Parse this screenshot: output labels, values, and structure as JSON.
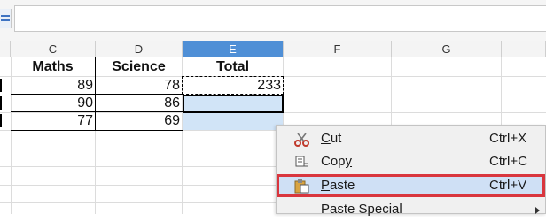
{
  "columns": [
    {
      "id": "C",
      "label": "C",
      "selected": false
    },
    {
      "id": "D",
      "label": "D",
      "selected": false
    },
    {
      "id": "E",
      "label": "E",
      "selected": true
    },
    {
      "id": "F",
      "label": "F",
      "selected": false
    },
    {
      "id": "G",
      "label": "G",
      "selected": false
    }
  ],
  "sheet": {
    "headers": {
      "maths": "Maths",
      "science": "Science",
      "total": "Total"
    },
    "rows": [
      {
        "maths": "89",
        "science": "78",
        "total": "233"
      },
      {
        "maths": "90",
        "science": "86",
        "total": ""
      },
      {
        "maths": "77",
        "science": "69",
        "total": ""
      }
    ]
  },
  "context_menu": {
    "items": [
      {
        "label_pre": "",
        "label_ul": "C",
        "label_post": "ut",
        "shortcut": "Ctrl+X",
        "icon": "scissors-icon"
      },
      {
        "label_pre": "Cop",
        "label_ul": "y",
        "label_post": "",
        "shortcut": "Ctrl+C",
        "icon": "copy-icon"
      },
      {
        "label_pre": "",
        "label_ul": "P",
        "label_post": "aste",
        "shortcut": "Ctrl+V",
        "icon": "paste-icon",
        "highlighted": true
      },
      {
        "label": "Paste Special",
        "icon": "",
        "submenu": true
      }
    ]
  },
  "colors": {
    "selected_header": "#4f8fd6",
    "selection_fill": "#d1e4f7",
    "highlight_border": "#d9363e"
  }
}
